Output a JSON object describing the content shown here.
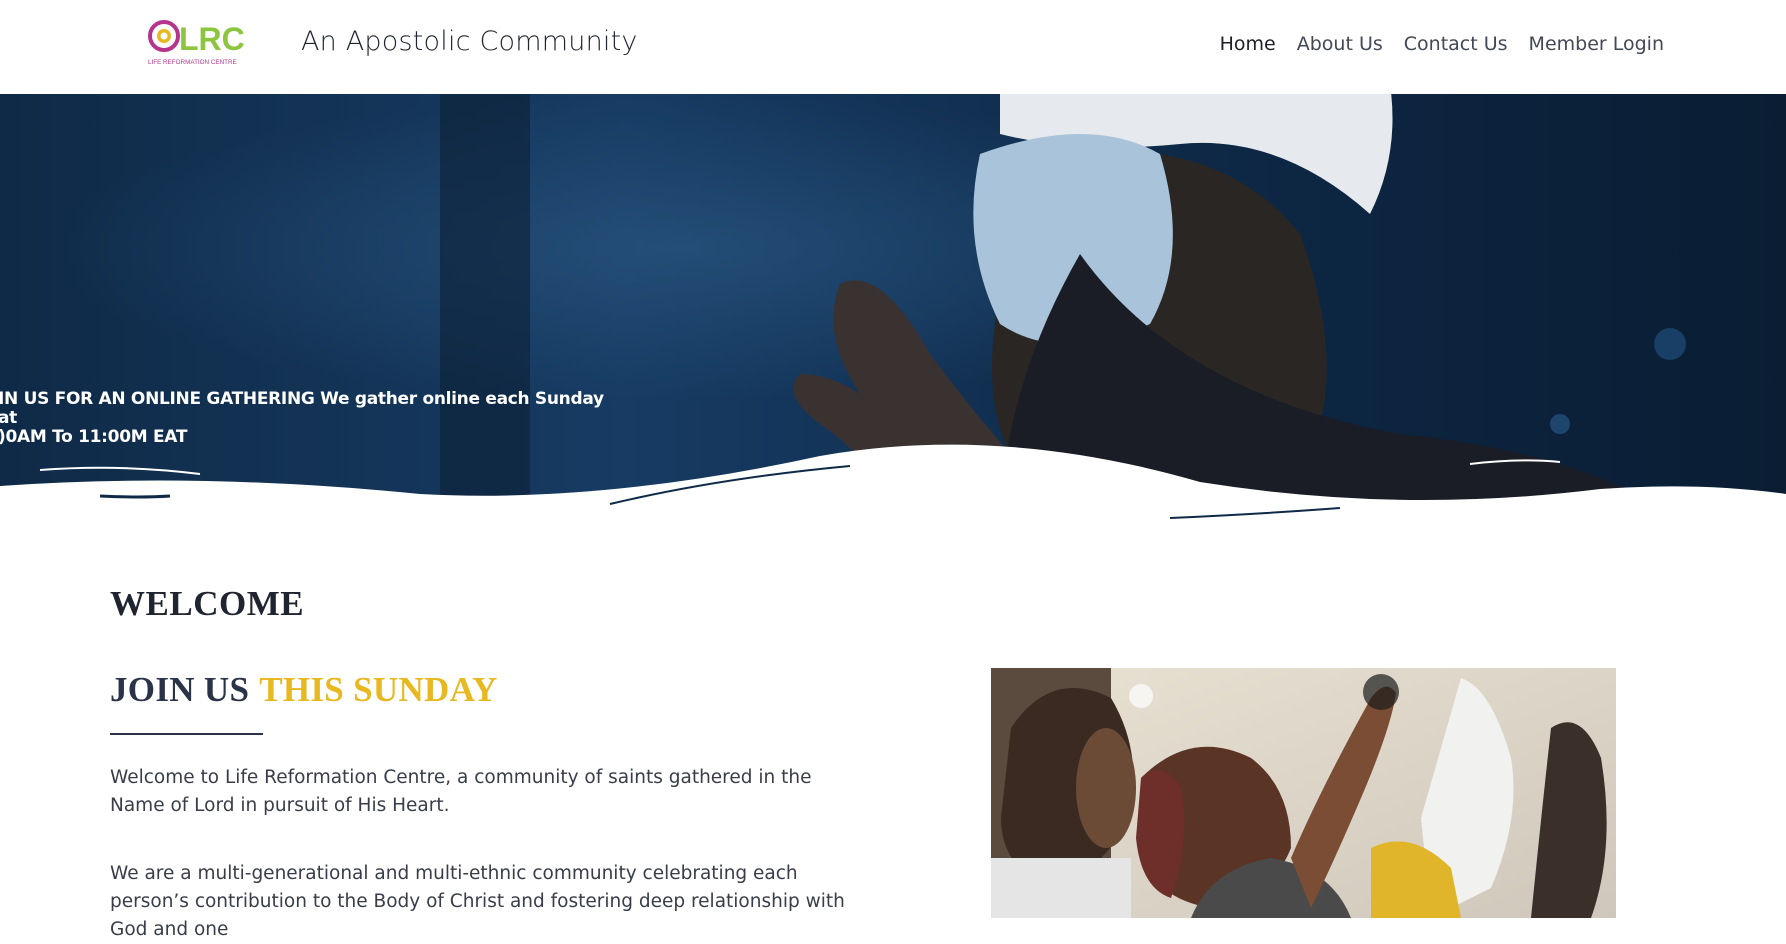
{
  "header": {
    "logo_text": "LRC",
    "logo_subtext": "LIFE REFORMATION CENTRE",
    "tagline": "An Apostolic Community",
    "nav": [
      {
        "label": "Home"
      },
      {
        "label": "About Us"
      },
      {
        "label": "Contact Us"
      },
      {
        "label": "Member Login"
      }
    ]
  },
  "hero": {
    "line1": "IN US FOR AN ONLINE GATHERING We gather online each Sunday at",
    "line2": ")0AM To 11:00M EAT"
  },
  "main": {
    "welcome": "WELCOME",
    "join_part1": "JOIN US",
    "join_part2": "THIS SUNDAY",
    "para1": "Welcome to Life Reformation Centre, a community of saints gathered in the Name of Lord in pursuit of His Heart.",
    "para2": "We are a multi-generational and multi-ethnic community celebrating each person’s contribution to the Body of Christ and fostering deep relationship with God and one"
  },
  "colors": {
    "accent_yellow": "#e8b820",
    "heading_navy": "#2a3348",
    "logo_green": "#8cc63f",
    "logo_magenta": "#b5348c"
  }
}
